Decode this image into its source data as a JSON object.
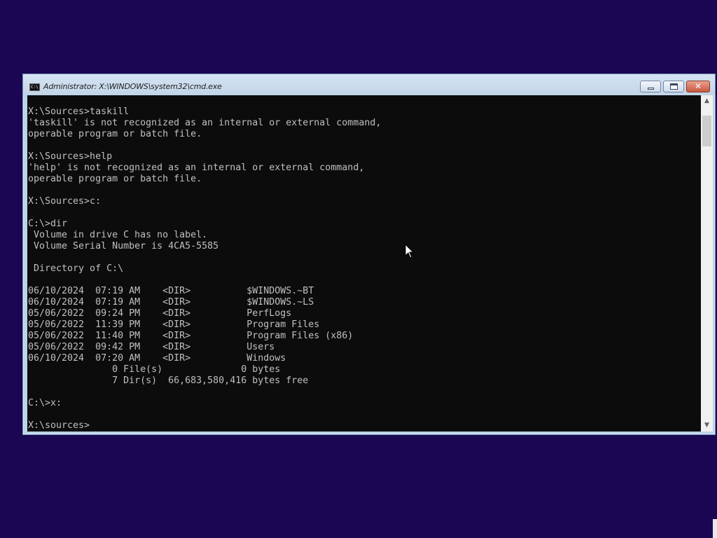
{
  "window": {
    "title": "Administrator: X:\\WINDOWS\\system32\\cmd.exe",
    "icon": "cmd-icon",
    "icon_text": "C:\\"
  },
  "console": {
    "lines": [
      "X:\\Sources>taskill",
      "'taskill' is not recognized as an internal or external command,",
      "operable program or batch file.",
      "",
      "X:\\Sources>help",
      "'help' is not recognized as an internal or external command,",
      "operable program or batch file.",
      "",
      "X:\\Sources>c:",
      "",
      "C:\\>dir",
      " Volume in drive C has no label.",
      " Volume Serial Number is 4CA5-5585",
      "",
      " Directory of C:\\",
      "",
      "06/10/2024  07:19 AM    <DIR>          $WINDOWS.~BT",
      "06/10/2024  07:19 AM    <DIR>          $WINDOWS.~LS",
      "05/06/2022  09:24 PM    <DIR>          PerfLogs",
      "05/06/2022  11:39 PM    <DIR>          Program Files",
      "05/06/2022  11:40 PM    <DIR>          Program Files (x86)",
      "05/06/2022  09:42 PM    <DIR>          Users",
      "06/10/2024  07:20 AM    <DIR>          Windows",
      "               0 File(s)              0 bytes",
      "               7 Dir(s)  66,683,580,416 bytes free",
      "",
      "C:\\>x:",
      "",
      "X:\\sources>"
    ]
  },
  "colors": {
    "desktop": "#1a0652",
    "console_bg": "#0c0c0c",
    "console_fg": "#c0c0c0",
    "close_button": "#c75840"
  },
  "icons": {
    "minimize": "minimize-icon",
    "maximize": "maximize-icon",
    "close": "close-icon",
    "scroll_up": "scroll-up-arrow-icon",
    "scroll_down": "scroll-down-arrow-icon",
    "cursor": "mouse-cursor-icon"
  }
}
